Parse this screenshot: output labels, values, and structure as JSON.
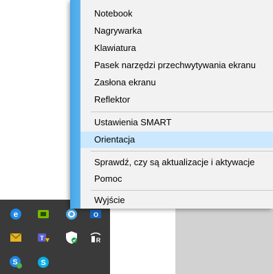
{
  "menu": {
    "items": [
      {
        "label": "Notebook"
      },
      {
        "label": "Nagrywarka"
      },
      {
        "label": "Klawiatura"
      },
      {
        "label": "Pasek narzędzi przechwytywania ekranu"
      },
      {
        "label": "Zasłona ekranu"
      },
      {
        "label": "Reflektor"
      },
      {
        "label": "Ustawienia SMART"
      },
      {
        "label": "Orientacja",
        "highlighted": true
      },
      {
        "label": "Sprawdź, czy są aktualizacje i aktywacje"
      },
      {
        "label": "Pomoc"
      },
      {
        "label": "Wyjście"
      }
    ]
  },
  "colors": {
    "menu_bg": "#f2f2f2",
    "highlight": "#cce8ff",
    "accent_strip": "#4aa8e8",
    "tray_bg": "#3a3a3a"
  },
  "tray": {
    "icons": [
      "edge-icon",
      "nvidia-icon",
      "smart-board-icon",
      "outlook-icon",
      "mail-icon",
      "teams-icon",
      "defender-shield-icon",
      "smart-r-icon",
      "skype-business-icon",
      "skype-icon"
    ]
  }
}
